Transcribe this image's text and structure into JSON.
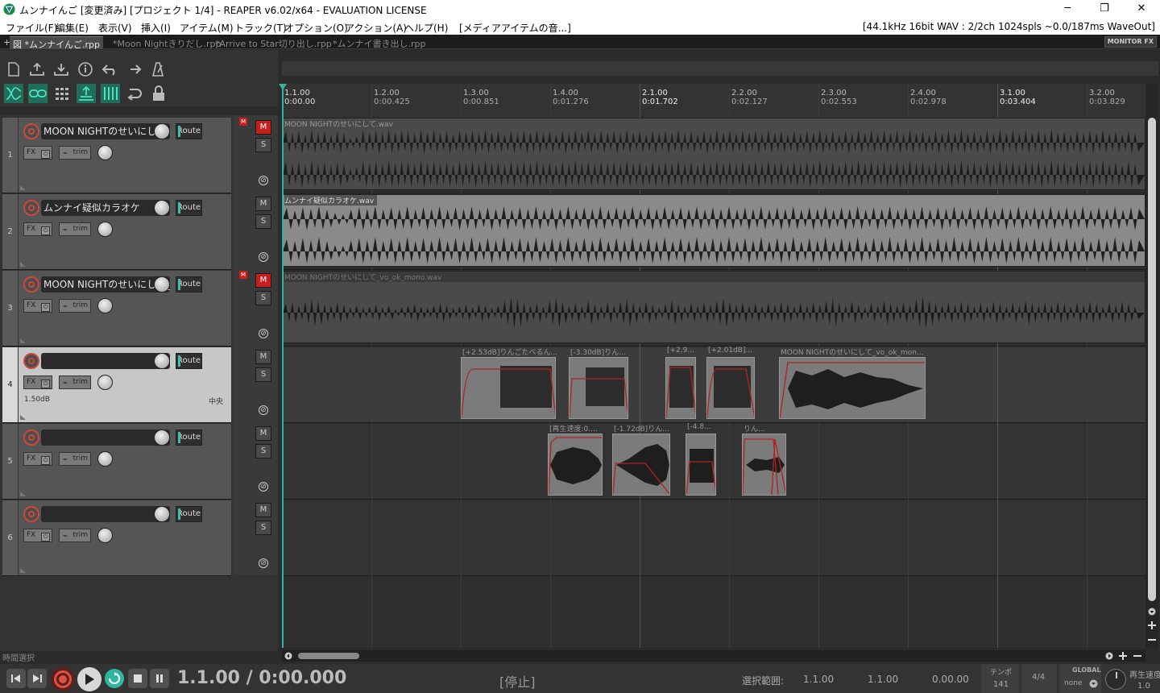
{
  "window": {
    "title": "ムンナイんご [変更済み] [プロジェクト 1/4] - REAPER v6.02/x64 - EVALUATION LICENSE",
    "minimize": "─",
    "maximize": "❐",
    "close": "✕"
  },
  "menu": {
    "items": [
      "ファイル(F)",
      "編集(E)",
      "表示(V)",
      "挿入(I)",
      "アイテム(M)",
      "トラック(T)",
      "オプション(O)",
      "アクション(A)",
      "ヘルプ(H)",
      "[メディアアイテムの音...]"
    ],
    "status": "[44.1kHz 16bit WAV : 2/2ch 1024spls ~0.0/187ms WaveOut]"
  },
  "tabs": {
    "add": "+",
    "items": [
      "図 *ムンナイんご.rpp",
      "*Moon Nightきりだし.rpp",
      "*Arrive to Star切り出し.rpp",
      "*ムンナイ書き出し.rpp"
    ],
    "monitor_fx": "MONITOR FX"
  },
  "toolbar": {
    "icons": [
      "new-file-icon",
      "open-project-icon",
      "save-icon",
      "info-icon",
      "undo-icon",
      "redo-icon",
      "metronome-icon",
      "ripple-edit-icon",
      "item-grouping-icon",
      "grid-snap-icon",
      "auto-crossfade-icon",
      "envelope-points-icon",
      "loop-icon",
      "lock-icon"
    ]
  },
  "tracks": [
    {
      "num": "1",
      "name": "MOON NIGHTのせいにして",
      "mute": true,
      "mflag": true,
      "info_left": "",
      "info_right": ""
    },
    {
      "num": "2",
      "name": "ムンナイ疑似カラオケ",
      "mute": false,
      "mflag": false,
      "info_left": "",
      "info_right": ""
    },
    {
      "num": "3",
      "name": "MOON NIGHTのせいにして_",
      "mute": true,
      "mflag": true,
      "info_left": "",
      "info_right": ""
    },
    {
      "num": "4",
      "name": "",
      "mute": false,
      "mflag": false,
      "info_left": "1.50dB",
      "info_right": "中央"
    },
    {
      "num": "5",
      "name": "",
      "mute": false,
      "mflag": false,
      "info_left": "",
      "info_right": ""
    },
    {
      "num": "6",
      "name": "",
      "mute": false,
      "mflag": false,
      "info_left": "",
      "info_right": ""
    }
  ],
  "track_labels": {
    "route": "Route",
    "fx": "FX",
    "trim": "trim",
    "mute": "M",
    "solo": "S",
    "phase": "⊘",
    "mflag": "M"
  },
  "ruler": [
    {
      "m": "1.1.00",
      "t": "0:00.00"
    },
    {
      "m": "1.2.00",
      "t": "0:00.425"
    },
    {
      "m": "1.3.00",
      "t": "0:00.851"
    },
    {
      "m": "1.4.00",
      "t": "0:01.276"
    },
    {
      "m": "2.1.00",
      "t": "0:01.702"
    },
    {
      "m": "2.2.00",
      "t": "0:02.127"
    },
    {
      "m": "2.3.00",
      "t": "0:02.553"
    },
    {
      "m": "2.4.00",
      "t": "0:02.978"
    },
    {
      "m": "3.1.00",
      "t": "0:03.404"
    },
    {
      "m": "3.2.00",
      "t": "0:03.829"
    }
  ],
  "items": {
    "full": [
      "MOON NIGHTのせいにして.wav",
      "ムンナイ疑似カラオケ.wav",
      "MOON NIGHTのせいにして_vo_ok_mono.wav"
    ],
    "t4": [
      "[+2.53dB]りんごたべるん...",
      "[-3.30dB]りん...",
      "[+2.9...",
      "[+2.01dB]...",
      "MOON NIGHTのせいにして_vo_ok_mon..."
    ],
    "t5": [
      "[再生速度:0....",
      "[-1.72dB]りん...",
      "[-4.8...",
      "りん..."
    ]
  },
  "status_left": "時間選択",
  "transport": {
    "position": "1.1.00 / 0:00.000",
    "state": "[停止]",
    "sel_label": "選択範囲:",
    "sel_start": "1.1.00",
    "sel_end": "1.1.00",
    "sel_len": "0.00.00",
    "tempo_label": "テンポ",
    "tempo": "141",
    "timesig": "4/4",
    "global_label": "GLOBAL",
    "global_value": "none",
    "rate_label": "再生速度",
    "rate": "1.0"
  }
}
